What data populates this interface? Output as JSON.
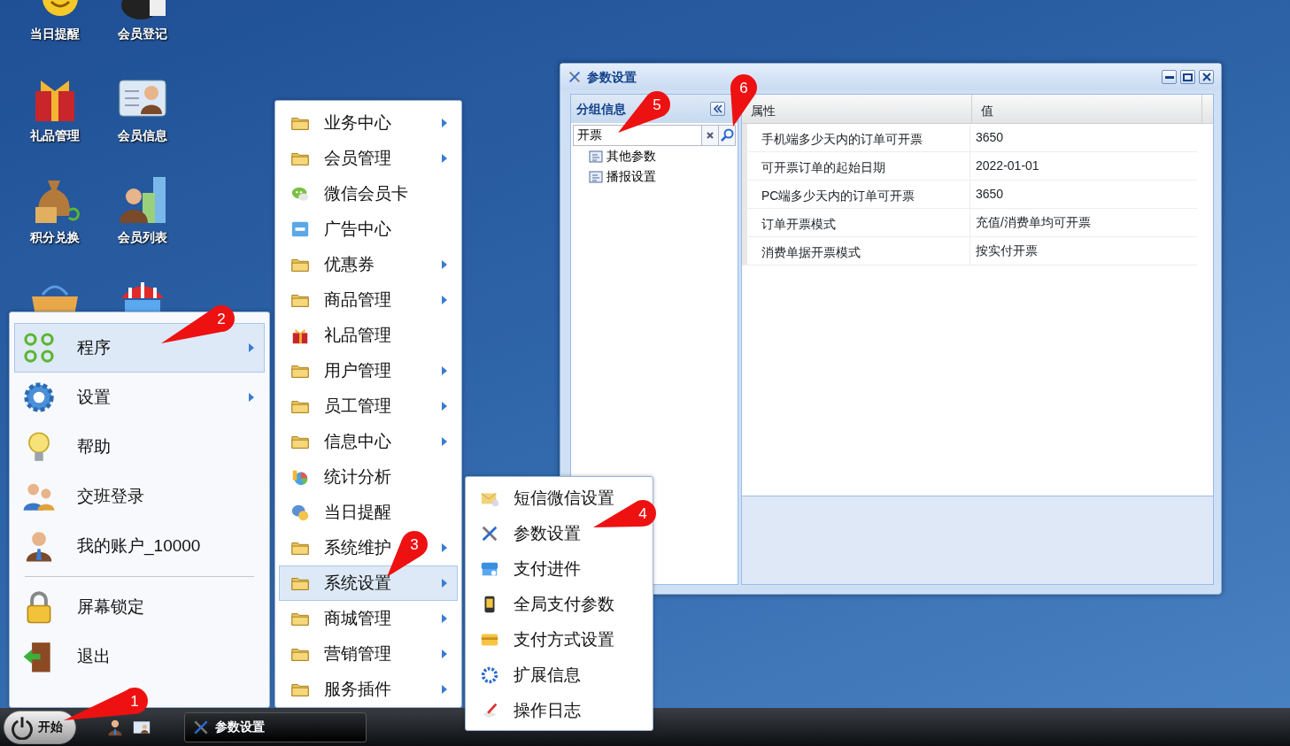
{
  "desktop_icons": [
    {
      "label": "当日提醒"
    },
    {
      "label": "会员登记"
    },
    {
      "label": "礼品管理"
    },
    {
      "label": "会员信息"
    },
    {
      "label": "积分兑换"
    },
    {
      "label": "会员列表"
    }
  ],
  "window": {
    "title": "参数设置",
    "group_panel": {
      "title": "分组信息",
      "search_value": "开票",
      "tree": [
        {
          "label": "其他参数"
        },
        {
          "label": "播报设置"
        }
      ]
    },
    "table": {
      "columns": [
        "属性",
        "值"
      ],
      "rows": [
        {
          "property": "手机端多少天内的订单可开票",
          "value": "3650"
        },
        {
          "property": "可开票订单的起始日期",
          "value": "2022-01-01"
        },
        {
          "property": "PC端多少天内的订单可开票",
          "value": "3650"
        },
        {
          "property": "订单开票模式",
          "value": "充值/消费单均可开票"
        },
        {
          "property": "消费单据开票模式",
          "value": "按实付开票"
        }
      ]
    }
  },
  "start_menu": {
    "items": [
      {
        "label": "程序",
        "selected": true,
        "has_submenu": true
      },
      {
        "label": "设置",
        "selected": false,
        "has_submenu": true
      },
      {
        "label": "帮助",
        "selected": false,
        "has_submenu": false
      },
      {
        "label": "交班登录",
        "selected": false,
        "has_submenu": false
      },
      {
        "label": "我的账户_10000",
        "selected": false,
        "has_submenu": false
      },
      {
        "label": "屏幕锁定",
        "selected": false,
        "has_submenu": false
      },
      {
        "label": "退出",
        "selected": false,
        "has_submenu": false
      }
    ]
  },
  "program_menu": {
    "items": [
      {
        "label": "业务中心",
        "selected": false,
        "has_submenu": true
      },
      {
        "label": "会员管理",
        "selected": false,
        "has_submenu": true
      },
      {
        "label": "微信会员卡",
        "selected": false,
        "has_submenu": false
      },
      {
        "label": "广告中心",
        "selected": false,
        "has_submenu": false
      },
      {
        "label": "优惠券",
        "selected": false,
        "has_submenu": true
      },
      {
        "label": "商品管理",
        "selected": false,
        "has_submenu": true
      },
      {
        "label": "礼品管理",
        "selected": false,
        "has_submenu": false
      },
      {
        "label": "用户管理",
        "selected": false,
        "has_submenu": true
      },
      {
        "label": "员工管理",
        "selected": false,
        "has_submenu": true
      },
      {
        "label": "信息中心",
        "selected": false,
        "has_submenu": true
      },
      {
        "label": "统计分析",
        "selected": false,
        "has_submenu": false
      },
      {
        "label": "当日提醒",
        "selected": false,
        "has_submenu": false
      },
      {
        "label": "系统维护",
        "selected": false,
        "has_submenu": true
      },
      {
        "label": "系统设置",
        "selected": true,
        "has_submenu": true
      },
      {
        "label": "商城管理",
        "selected": false,
        "has_submenu": true
      },
      {
        "label": "营销管理",
        "selected": false,
        "has_submenu": true
      },
      {
        "label": "服务插件",
        "selected": false,
        "has_submenu": true
      }
    ]
  },
  "settings_menu": {
    "items": [
      {
        "label": "短信微信设置"
      },
      {
        "label": "参数设置"
      },
      {
        "label": "支付进件"
      },
      {
        "label": "全局支付参数"
      },
      {
        "label": "支付方式设置"
      },
      {
        "label": "扩展信息"
      },
      {
        "label": "操作日志"
      }
    ]
  },
  "taskbar": {
    "start_label": "开始",
    "tasks": [
      {
        "label": "参数设置"
      }
    ]
  },
  "callouts": [
    {
      "number": "1"
    },
    {
      "number": "2"
    },
    {
      "number": "3"
    },
    {
      "number": "4"
    },
    {
      "number": "5"
    },
    {
      "number": "6"
    }
  ]
}
